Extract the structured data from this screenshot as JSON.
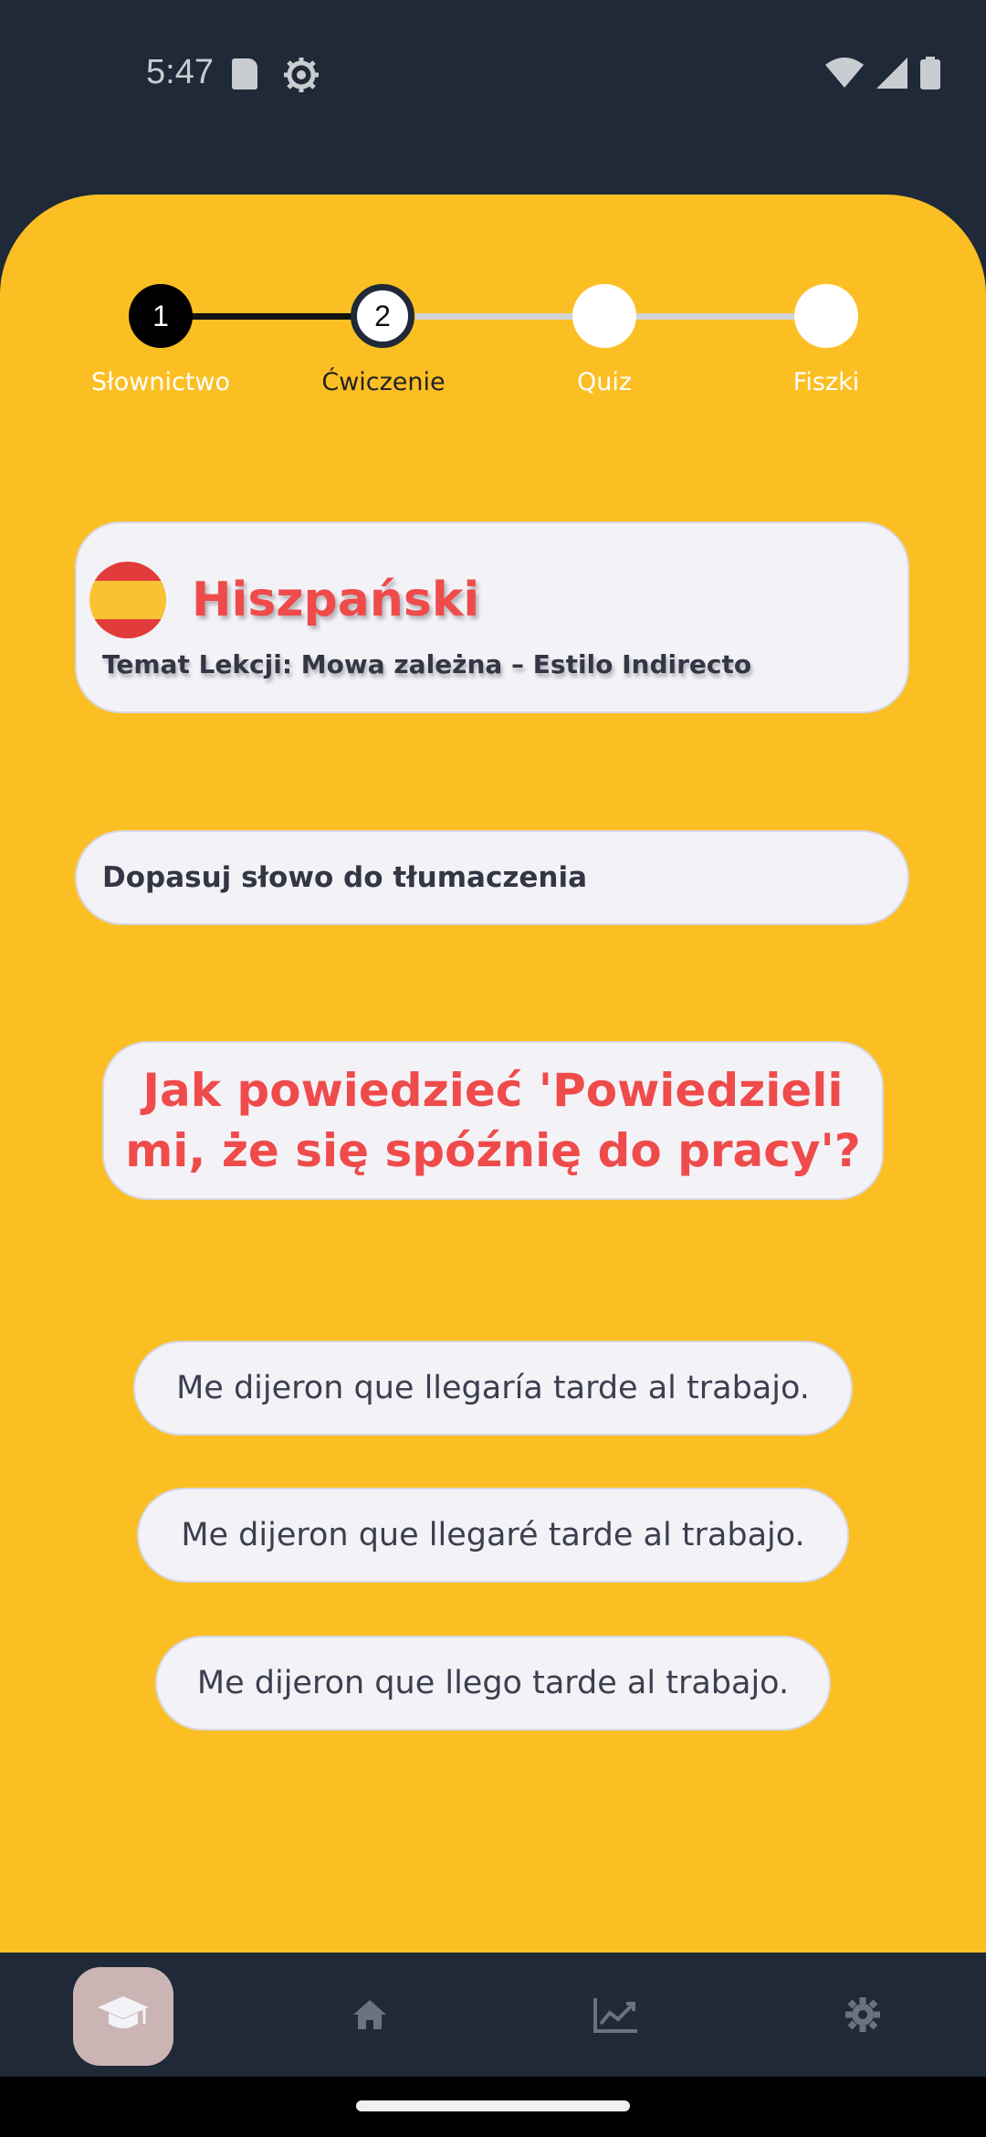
{
  "status_bar": {
    "time": "5:47",
    "icons": [
      "sd-card-icon",
      "settings-gear-icon",
      "wifi-icon",
      "signal-icon",
      "battery-icon"
    ]
  },
  "stepper": {
    "steps": [
      {
        "number": "1",
        "label": "Słownictwo",
        "state": "completed"
      },
      {
        "number": "2",
        "label": "Ćwiczenie",
        "state": "current"
      },
      {
        "number": "",
        "label": "Quiz",
        "state": "upcoming"
      },
      {
        "number": "",
        "label": "Fiszki",
        "state": "upcoming"
      }
    ]
  },
  "lesson": {
    "language": "Hiszpański",
    "flag_icon": "spain-flag-icon",
    "topic": "Temat Lekcji: Mowa zależna – Estilo Indirecto"
  },
  "exercise": {
    "instruction": "Dopasuj słowo do tłumaczenia",
    "question": "Jak powiedzieć 'Powiedzieli mi, że się spóźnię do pracy'?",
    "answers": [
      "Me dijeron que llegaría tarde al trabajo.",
      "Me dijeron que llegaré tarde al trabajo.",
      "Me dijeron que llego tarde al trabajo."
    ]
  },
  "bottom_nav": {
    "items": [
      {
        "icon": "graduation-cap-icon",
        "active": true
      },
      {
        "icon": "home-icon",
        "active": false
      },
      {
        "icon": "chart-trend-icon",
        "active": false
      },
      {
        "icon": "settings-gear-icon",
        "active": false
      }
    ]
  },
  "colors": {
    "background_dark": "#1f2937",
    "panel_yellow": "#fbbf24",
    "accent_red": "#ef4b4b",
    "card_bg": "#f3f2f7",
    "text_dark": "#333644"
  }
}
